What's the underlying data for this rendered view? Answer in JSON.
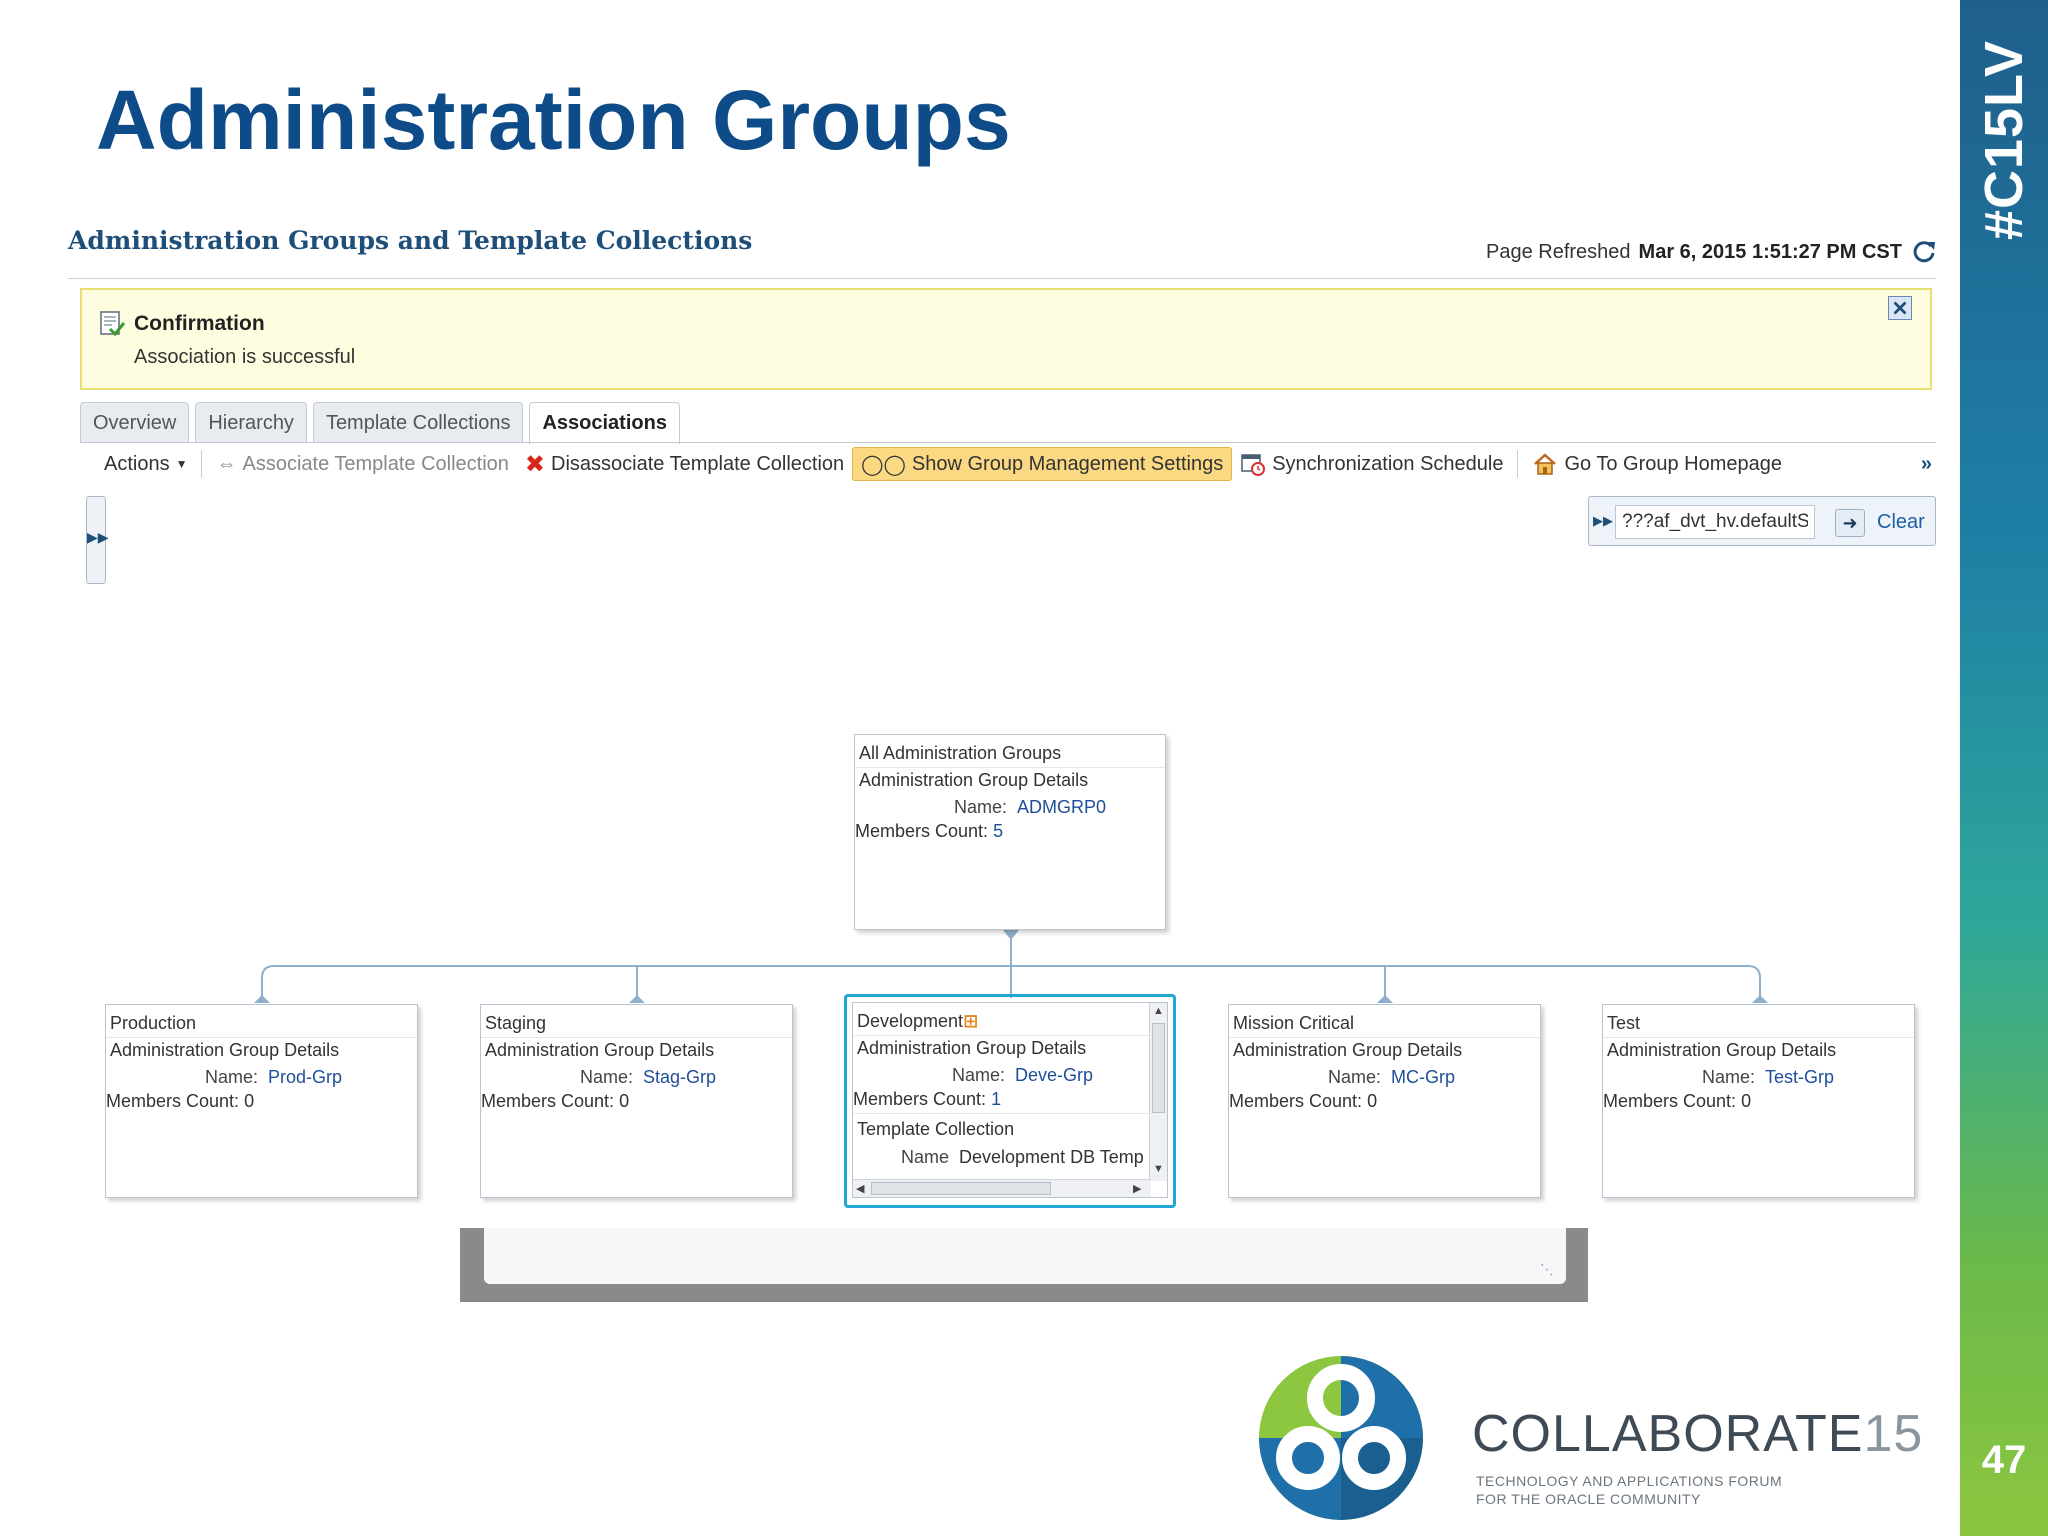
{
  "slide": {
    "title": "Administration Groups",
    "hashtag": "#C15LV",
    "number": "47"
  },
  "app": {
    "header": "Administration Groups and Template Collections",
    "refreshed_label": "Page Refreshed",
    "refreshed_value": "Mar 6, 2015 1:51:27 PM CST",
    "confirmation": {
      "title": "Confirmation",
      "message": "Association is successful"
    },
    "tabs": [
      "Overview",
      "Hierarchy",
      "Template Collections",
      "Associations"
    ],
    "active_tab": "Associations",
    "toolbar": {
      "actions": "Actions",
      "associate": "Associate Template Collection",
      "disassociate": "Disassociate Template Collection",
      "show_settings": "Show Group Management Settings",
      "sync_schedule": "Synchronization Schedule",
      "go_home": "Go To Group Homepage",
      "more": "»"
    },
    "search": {
      "value": "???af_dvt_hv.defaultS",
      "clear": "Clear"
    }
  },
  "hierarchy": {
    "root": {
      "title": "All Administration Groups",
      "subtitle": "Administration Group Details",
      "name_label": "Name:",
      "name": "ADMGRP0",
      "count_label": "Members Count:",
      "count": "5"
    },
    "children": [
      {
        "title": "Production",
        "subtitle": "Administration Group Details",
        "name_label": "Name:",
        "name": "Prod-Grp",
        "count_label": "Members Count:",
        "count": "0"
      },
      {
        "title": "Staging",
        "subtitle": "Administration Group Details",
        "name_label": "Name:",
        "name": "Stag-Grp",
        "count_label": "Members Count:",
        "count": "0"
      },
      {
        "title": "Development",
        "subtitle": "Administration Group Details",
        "name_label": "Name:",
        "name": "Deve-Grp",
        "count_label": "Members Count:",
        "count": "1",
        "template_label": "Template Collection",
        "template_name_label": "Name",
        "template_name": "Development DB Temp"
      },
      {
        "title": "Mission Critical",
        "subtitle": "Administration Group Details",
        "name_label": "Name:",
        "name": "MC-Grp",
        "count_label": "Members Count:",
        "count": "0"
      },
      {
        "title": "Test",
        "subtitle": "Administration Group Details",
        "name_label": "Name:",
        "name": "Test-Grp",
        "count_label": "Members Count:",
        "count": "0"
      }
    ]
  },
  "branding": {
    "collaborate": "COLLABORATE",
    "year": "15",
    "tagline_1": "TECHNOLOGY AND APPLICATIONS FORUM",
    "tagline_2": "FOR THE ORACLE COMMUNITY"
  },
  "colors": {
    "title_blue": "#0d4c88",
    "highlight": "#fbd982",
    "selected_frame": "#20a7d4",
    "link_blue": "#1f4e99"
  }
}
